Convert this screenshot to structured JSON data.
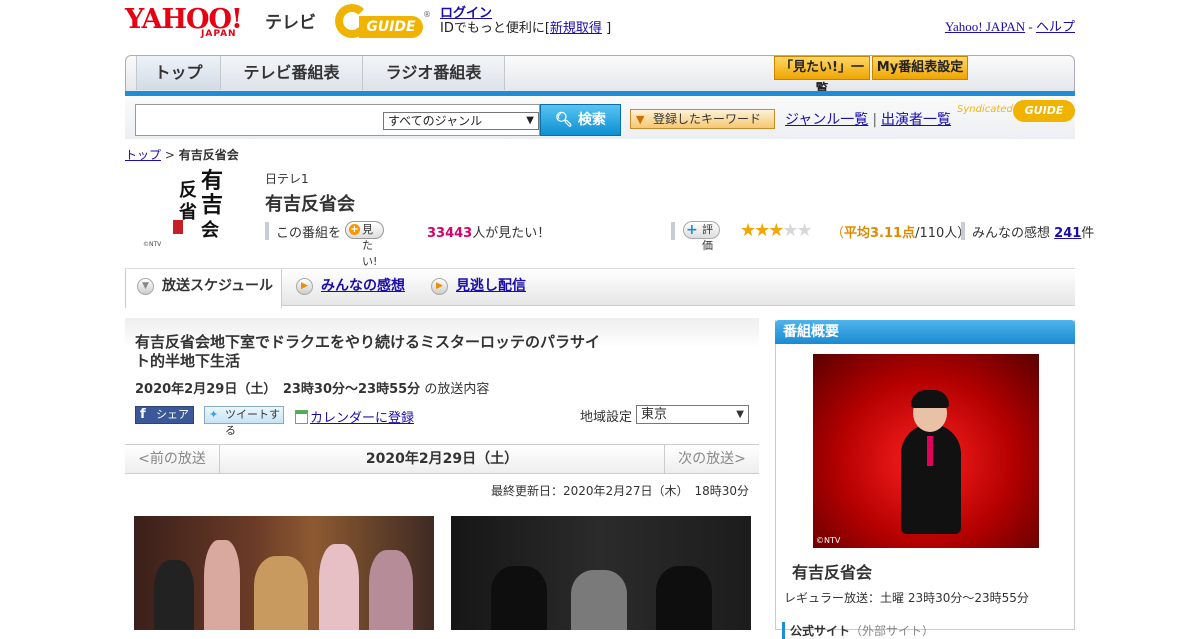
{
  "header": {
    "logo_text": "YAHOO!",
    "logo_sub": "JAPAN",
    "service": "テレビ",
    "gguide": "GUIDE",
    "login": "ログイン",
    "login_sub_pre": "IDでもっと便利に[",
    "signup": "新規取得",
    "login_sub_post": "]",
    "yahoo_japan": "Yahoo! JAPAN",
    "sep": "-",
    "help": "ヘルプ"
  },
  "gnav": {
    "tabs": [
      "トップ",
      "テレビ番組表",
      "ラジオ番組表"
    ],
    "mitai_list": "「見たい!」一覧",
    "my_schedule": "My番組表設定"
  },
  "search": {
    "placeholder": "",
    "genre": "すべてのジャンル",
    "button": "検索",
    "keywords": "登録したキーワード",
    "genre_list": "ジャンル一覧",
    "divider": "|",
    "performers": "出演者一覧",
    "syndicated": "Syndicated",
    "guide": "GUIDE"
  },
  "breadcrumb": {
    "top": "トップ",
    "sep": ">",
    "current": "有吉反省会"
  },
  "program": {
    "logo_chars": [
      "有",
      "吉",
      "反",
      "省",
      "会"
    ],
    "logo_ntv": "©NTV",
    "channel": "日テレ1",
    "title": "有吉反省会",
    "mitai_prefix": "この番組を",
    "mitai_btn": "見たい!",
    "mitai_count": "33443",
    "mitai_suffix": "人が見たい！",
    "rating_btn": "評価",
    "rating_value": 3.11,
    "stars_on": "★★★",
    "stars_off": "★★",
    "rating_open": "（",
    "rating_avg": "平均3.11点",
    "rating_people": "/110人）",
    "reviews_prefix": "みんなの感想",
    "reviews_count": "241",
    "reviews_suffix": "件"
  },
  "subtabs": {
    "schedule": "放送スケジュール",
    "reviews": "みんなの感想",
    "streaming": "見逃し配信"
  },
  "episode": {
    "title": "有吉反省会地下室でドラクエをやり続けるミスターロッテのパラサイト的半地下生活",
    "date": "2020年2月29日（土）　23時30分～23時55分",
    "date_suffix": "の放送内容",
    "fb_share": "シェア",
    "tweet": "ツイートする",
    "calendar": "カレンダーに登録",
    "region_label": "地域設定",
    "region_value": "東京",
    "prev": "<前の放送",
    "current_date": "2020年2月29日（土）",
    "next": "次の放送>",
    "updated": "最終更新日：2020年2月27日（木）　18時30分"
  },
  "sidebar": {
    "header": "番組概要",
    "photo_credit": "©NTV",
    "name": "有吉反省会",
    "regular": "レギュラー放送：土曜 23時30分～23時55分",
    "official_site": "公式サイト",
    "external": "（外部サイト）"
  },
  "colors": {
    "accent_blue": "#1f8dd6",
    "yahoo_red": "#e60012",
    "gguide_yellow": "#f0b400",
    "link": "#1a0dab",
    "count_pink": "#d6006f"
  }
}
